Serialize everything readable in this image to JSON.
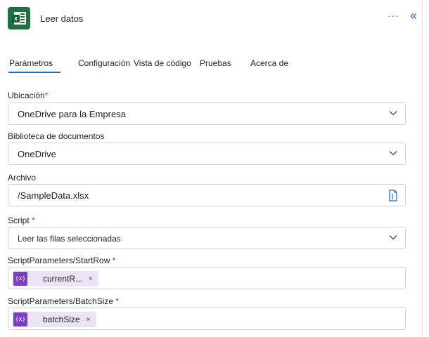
{
  "header": {
    "title": "Leer datos",
    "more_label": "···",
    "collapse_label": "«"
  },
  "tabs": [
    {
      "label": "Parámetros",
      "active": true
    },
    {
      "label": "Configuración"
    },
    {
      "label": "Vista de código"
    },
    {
      "label": "Pruebas"
    },
    {
      "label": "Acerca de"
    }
  ],
  "fields": {
    "location": {
      "label": "Ubicación",
      "required_mark": "*",
      "value": "OneDrive para la Empresa"
    },
    "library": {
      "label": "Biblioteca de documentos",
      "value": "OneDrive"
    },
    "file": {
      "label": "Archivo",
      "value": "/SampleData.xlsx"
    },
    "script": {
      "label": "Script",
      "required_mark": "*",
      "value": "Leer las filas seleccionadas"
    },
    "start_row": {
      "label": "ScriptParameters/StartRow",
      "required_mark": "*",
      "token": "currentR...",
      "token_icon": "{x}",
      "close": "×"
    },
    "batch_size": {
      "label": "ScriptParameters/BatchSize",
      "required_mark": "*",
      "token": "batchSize",
      "token_icon": "{x}",
      "close": "×"
    }
  },
  "colors": {
    "accent": "#2266c9",
    "excel_green": "#1e7145",
    "token_bg": "#ece3f5",
    "token_icon_bg": "#7a3ec2",
    "required": "#c4314b"
  },
  "icons": {
    "app": "excel-icon",
    "dropdown": "chevron-down-icon",
    "file_picker": "file-icon",
    "variable": "variable-icon"
  }
}
